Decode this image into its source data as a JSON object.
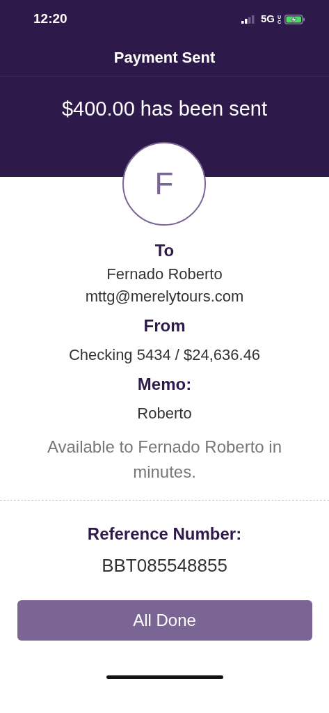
{
  "status_bar": {
    "time": "12:20",
    "network": "5G",
    "network_badge": "UC"
  },
  "header": {
    "title": "Payment Sent",
    "amount_text": "$400.00 has been sent"
  },
  "recipient": {
    "initial": "F"
  },
  "details": [
    {
      "label": "To",
      "lines": [
        "Fernado Roberto",
        "mttg@merelytours.com"
      ]
    },
    {
      "label": "From",
      "lines": [
        "Checking 5434 / $24,636.46"
      ]
    },
    {
      "label": "Memo:",
      "lines": [
        "Roberto"
      ]
    }
  ],
  "availability_note": "Available to Fernado Roberto in minutes.",
  "reference": {
    "label": "Reference Number:",
    "value": "BBT085548855"
  },
  "buttons": [
    {
      "label": "All Done"
    }
  ]
}
